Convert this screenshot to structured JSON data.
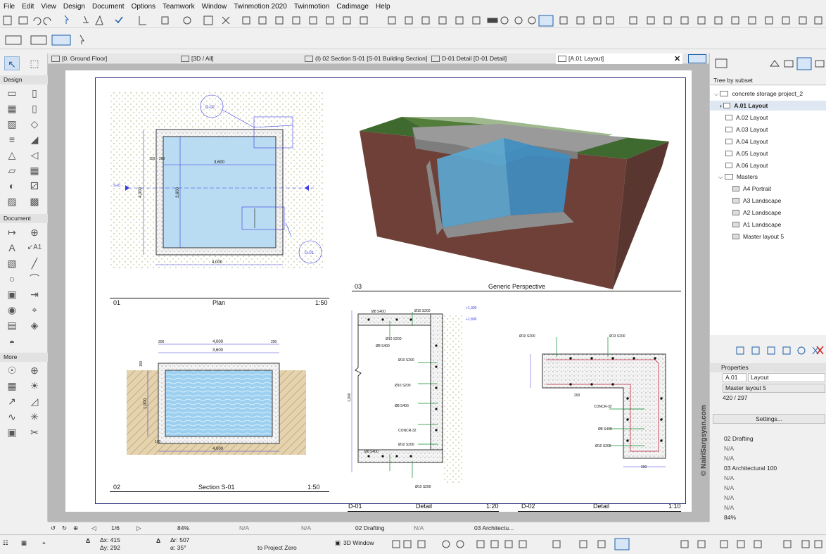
{
  "menu": [
    "File",
    "Edit",
    "View",
    "Design",
    "Document",
    "Options",
    "Teamwork",
    "Window",
    "Twinmotion 2020",
    "Twinmotion",
    "Cadimage",
    "Help"
  ],
  "tabs": [
    {
      "label": "[0. Ground Floor]",
      "active": false
    },
    {
      "label": "[3D / All]",
      "active": false
    },
    {
      "label": "(I) 02 Section S-01 [S-01 Building Section]",
      "active": false
    },
    {
      "label": "D-01 Detail [D-01 Detail]",
      "active": false
    },
    {
      "label": "[A.01 Layout]",
      "active": true
    }
  ],
  "toolbox": {
    "design_label": "Design",
    "document_label": "Document",
    "more_label": "More"
  },
  "views": {
    "plan": {
      "number": "01",
      "name": "Plan",
      "scale": "1:50"
    },
    "perspective": {
      "number": "03",
      "name": "Generic Perspective"
    },
    "section": {
      "number": "02",
      "name": "Section S-01",
      "scale": "1:50"
    },
    "detail1": {
      "number": "D-01",
      "name": "Detail",
      "scale": "1:20"
    },
    "detail2": {
      "number": "D-02",
      "name": "Detail",
      "scale": "1:10"
    }
  },
  "drawing_text": {
    "plan_top_dim": "3,600",
    "plan_bottom_dim": "4,000",
    "plan_left_dim": "4,000",
    "plan_inner_left_dim": "3,600",
    "plan_wall": "100",
    "plan_wall2": "200",
    "plan_tag_d02": "D-02",
    "plan_tag_d01": "D-01",
    "plan_sec_mark": "S-01",
    "sec_top_dim": "4,000",
    "sec_inner_dim": "3,600",
    "sec_bottom_dim": "4,000",
    "sec_wall": "200",
    "sec_height": "1,900",
    "sec_150": "150",
    "sec_100": "100",
    "d01_top_rebar": "Ø10 S200",
    "d01_top_rebar2": "Ø8 S400",
    "d01_rebar_a": "Ø10 S200",
    "d01_rebar_b": "Ø8 S400",
    "d01_rebar_c": "Ø10 S200",
    "d01_rebar_d": "Ø8 S400",
    "d01_concr": "CONCR-32",
    "d01_rebar_e": "Ø10 S200",
    "d01_rebar_f": "Ø8 S400",
    "d01_rebar_g": "Ø10 S200",
    "d01_lvl1": "+1,300",
    "d01_lvl2": "+1,800",
    "d01_h": "1,900",
    "d02_rebar1": "Ø10 S200",
    "d02_rebar2": "Ø13 S200",
    "d02_concr": "CONCR-32",
    "d02_rebar3": "Ø8 S400",
    "d02_rebar4": "Ø10 S200",
    "d02_dim1": "200",
    "d02_dim2": "200"
  },
  "navigator": {
    "mode": "Tree by subset",
    "project": "concrete storage project_2",
    "layouts": [
      "A.01 Layout",
      "A.02 Layout",
      "A.03 Layout",
      "A.04 Layout",
      "A.05 Layout",
      "A.06 Layout"
    ],
    "masters_label": "Masters",
    "masters": [
      "A4 Portrait",
      "A3 Landscape",
      "A2 Landscape",
      "A1 Landscape",
      "Master layout 5"
    ]
  },
  "properties": {
    "title": "Properties",
    "id": "A.01",
    "name": "Layout",
    "master": "Master layout 5",
    "size": "420 / 297",
    "settings_label": "Settings..."
  },
  "layers": {
    "items": [
      "02 Drafting",
      "N/A",
      "N/A",
      "03 Architectural 100",
      "N/A",
      "N/A",
      "N/A",
      "N/A",
      "84%",
      "N/A"
    ]
  },
  "watermark": "© NairiSargsyan.com",
  "statusbar": {
    "page": "1/6",
    "zoom": "84%",
    "na1": "N/A",
    "na2": "N/A",
    "layer": "02 Drafting",
    "na3": "N/A",
    "pen": "03 Architectu..."
  },
  "infobar": {
    "dx": "Δx: 415",
    "dy": "Δy: 292",
    "dr": "Δr: 507",
    "da": "α: 35°",
    "zero_label": "to Project Zero",
    "window3d": "3D Window"
  },
  "colors": {
    "accent_blue": "#1e5fa8",
    "water": "#aee0f5",
    "grass": "#3b5f2a"
  }
}
